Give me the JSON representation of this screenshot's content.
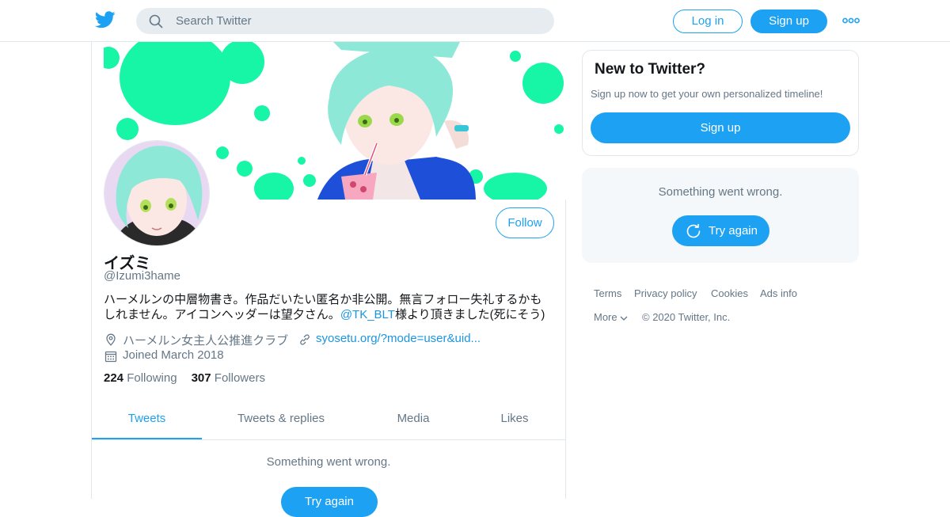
{
  "header": {
    "search_placeholder": "Search Twitter",
    "login_label": "Log in",
    "signup_label": "Sign up"
  },
  "profile": {
    "name": "イズミ",
    "handle": "@Izumi3hame",
    "bio_line1": "ハーメルンの中層物書き。作品だいたい匿名か非公開。無言フォロー失礼するかも",
    "bio_line2_pre": "しれません。アイコンヘッダーは望夕さん。",
    "bio_mention": "@TK_BLT",
    "bio_line2_post": "様より頂きました(死にそう)",
    "location": "ハーメルン女主人公推進クラブ",
    "website": "syosetu.org/?mode=user&uid...",
    "joined": "Joined March 2018",
    "following_count": "224",
    "following_label": "Following",
    "followers_count": "307",
    "followers_label": "Followers",
    "follow_label": "Follow"
  },
  "tabs": [
    {
      "label": "Tweets",
      "active": true
    },
    {
      "label": "Tweets & replies",
      "active": false
    },
    {
      "label": "Media",
      "active": false
    },
    {
      "label": "Likes",
      "active": false
    }
  ],
  "feed": {
    "error_message": "Something went wrong.",
    "retry_label": "Try again"
  },
  "sidebar": {
    "new_title": "New to Twitter?",
    "new_sub": "Sign up now to get your own personalized timeline!",
    "signup_label": "Sign up",
    "error_message": "Something went wrong.",
    "retry_label": "Try again"
  },
  "footer": {
    "links": [
      "Terms",
      "Privacy policy",
      "Cookies",
      "Ads info"
    ],
    "more_label": "More",
    "copyright": "© 2020 Twitter, Inc."
  },
  "colors": {
    "accent": "#1da1f2",
    "link": "#1b95e0",
    "muted": "#657786",
    "banner_splash": "#17f5a6"
  }
}
